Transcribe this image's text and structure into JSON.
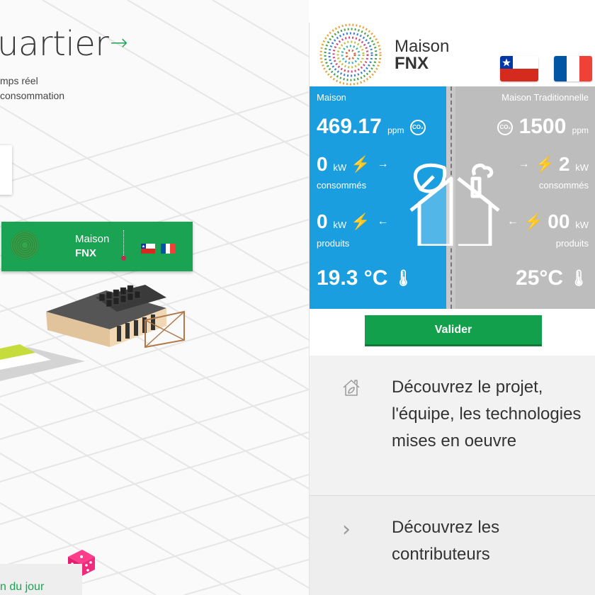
{
  "map": {
    "title": "uartier",
    "subtitle_line1": "mps réel",
    "subtitle_line2": "consommation",
    "banner": {
      "name_top": "Maison",
      "name_bottom": "FNX"
    },
    "daily_label": "n du jour"
  },
  "header": {
    "house_name_top": "Maison",
    "house_name_bottom": "FNX",
    "flags": [
      "chile-flag",
      "france-flag"
    ]
  },
  "compare": {
    "left": {
      "label": "Maison",
      "co2_value": "469.17",
      "co2_unit": "ppm",
      "consumed_value": "0",
      "consumed_unit": "kW",
      "consumed_label": "consommés",
      "produced_value": "0",
      "produced_unit": "kW",
      "produced_label": "produits",
      "temperature": "19.3 °C"
    },
    "right": {
      "label": "Maison Traditionnelle",
      "co2_value": "1500",
      "co2_unit": "ppm",
      "consumed_value": "2",
      "consumed_unit": "kW",
      "consumed_label": "consommés",
      "produced_value": "00",
      "produced_unit": "kW",
      "produced_label": "produits",
      "temperature": "25°C"
    },
    "co2_badge": "CO₂"
  },
  "actions": {
    "validate_label": "Valider"
  },
  "info": {
    "project_text": "Découvrez le projet, l'équipe, les technologies mises en oeuvre",
    "contributors_text": "Découvrez les contributeurs"
  },
  "colors": {
    "accent_green": "#1aa352",
    "blue_panel": "#1a9ee0",
    "gray_panel": "#bdbdbd"
  }
}
